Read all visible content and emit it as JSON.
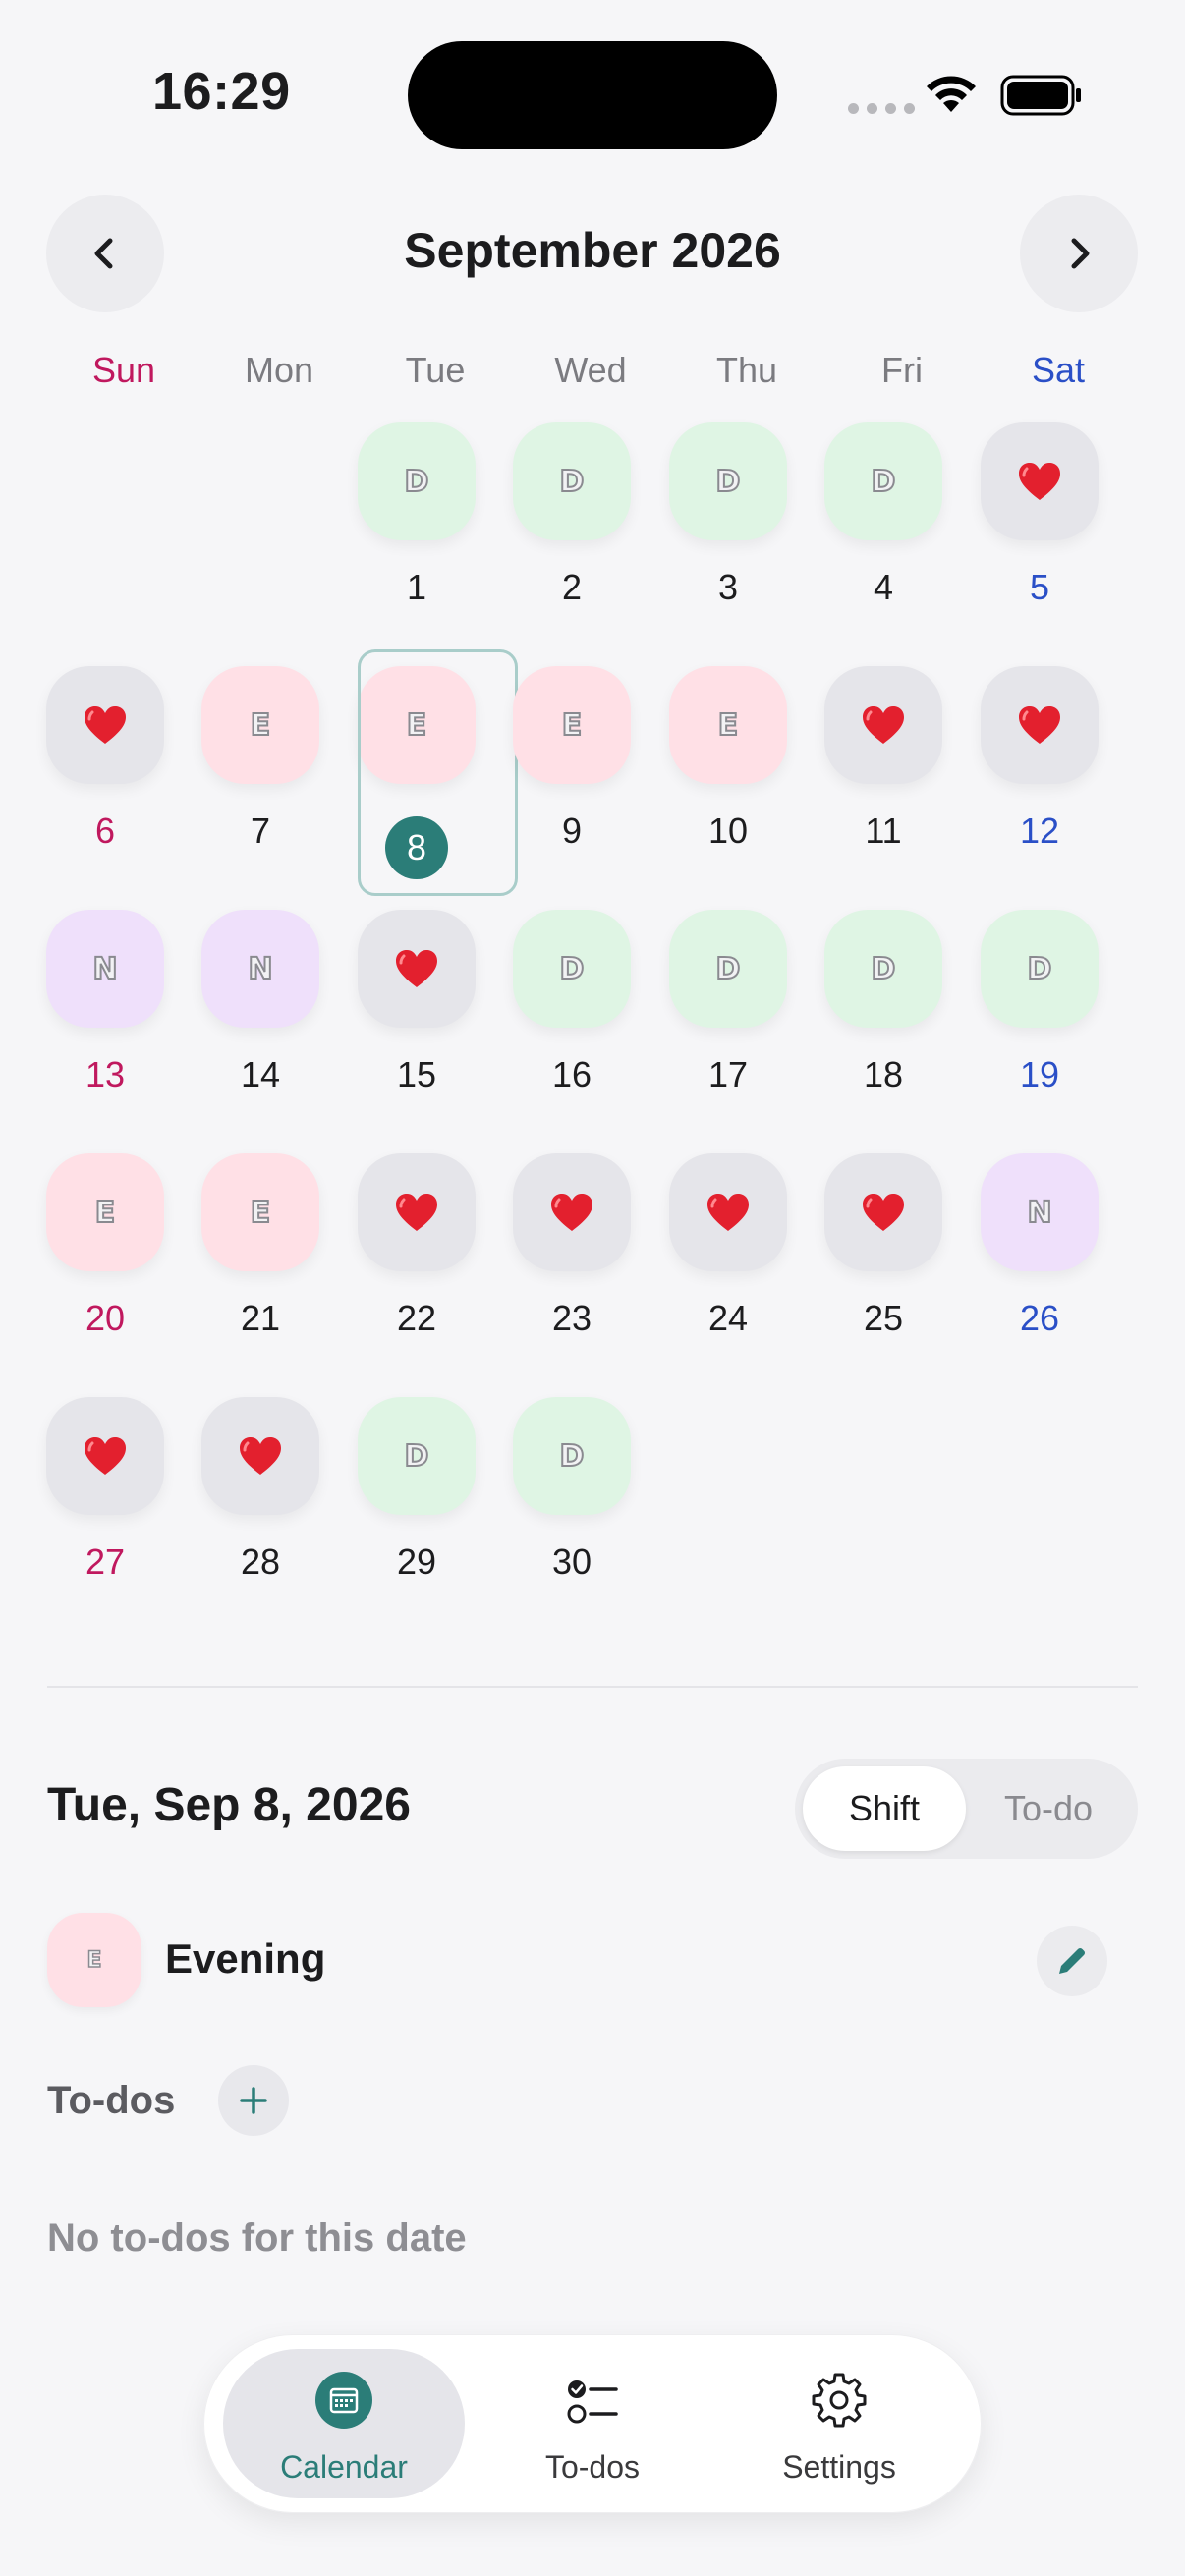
{
  "status": {
    "time": "16:29"
  },
  "header": {
    "title": "September 2026",
    "prev_icon": "chevron-left-icon",
    "next_icon": "chevron-right-icon"
  },
  "weekdays": [
    "Sun",
    "Mon",
    "Tue",
    "Wed",
    "Thu",
    "Fri",
    "Sat"
  ],
  "calendar": {
    "first_weekday": 2,
    "selected_day": 8,
    "days": [
      {
        "day": "1",
        "shift": "D"
      },
      {
        "day": "2",
        "shift": "D"
      },
      {
        "day": "3",
        "shift": "D"
      },
      {
        "day": "4",
        "shift": "D"
      },
      {
        "day": "5",
        "shift": "off"
      },
      {
        "day": "6",
        "shift": "off"
      },
      {
        "day": "7",
        "shift": "E"
      },
      {
        "day": "8",
        "shift": "E"
      },
      {
        "day": "9",
        "shift": "E"
      },
      {
        "day": "10",
        "shift": "E"
      },
      {
        "day": "11",
        "shift": "off"
      },
      {
        "day": "12",
        "shift": "off"
      },
      {
        "day": "13",
        "shift": "N"
      },
      {
        "day": "14",
        "shift": "N"
      },
      {
        "day": "15",
        "shift": "off"
      },
      {
        "day": "16",
        "shift": "D"
      },
      {
        "day": "17",
        "shift": "D"
      },
      {
        "day": "18",
        "shift": "D"
      },
      {
        "day": "19",
        "shift": "D"
      },
      {
        "day": "20",
        "shift": "E"
      },
      {
        "day": "21",
        "shift": "E"
      },
      {
        "day": "22",
        "shift": "off"
      },
      {
        "day": "23",
        "shift": "off"
      },
      {
        "day": "24",
        "shift": "off"
      },
      {
        "day": "25",
        "shift": "off"
      },
      {
        "day": "26",
        "shift": "N"
      },
      {
        "day": "27",
        "shift": "off"
      },
      {
        "day": "28",
        "shift": "off"
      },
      {
        "day": "29",
        "shift": "D"
      },
      {
        "day": "30",
        "shift": "D"
      }
    ]
  },
  "colors": {
    "accent": "#2b7d78",
    "sunday": "#c0185e",
    "saturday": "#2a4fc7",
    "day_shift": "#dff5e4",
    "evening_shift": "#ffe0e6",
    "night_shift": "#efe0fb",
    "off": "#e5e5ea"
  },
  "detail": {
    "date": "Tue, Sep 8, 2026",
    "segment": {
      "shift": "Shift",
      "todo": "To-do",
      "active": "Shift"
    },
    "shift": {
      "letter": "E",
      "name": "Evening"
    },
    "todos_label": "To-dos",
    "empty_text": "No to-dos for this date"
  },
  "tabbar": {
    "tabs": [
      {
        "label": "Calendar",
        "icon": "calendar-icon",
        "active": true
      },
      {
        "label": "To-dos",
        "icon": "checklist-icon",
        "active": false
      },
      {
        "label": "Settings",
        "icon": "gear-icon",
        "active": false
      }
    ]
  }
}
